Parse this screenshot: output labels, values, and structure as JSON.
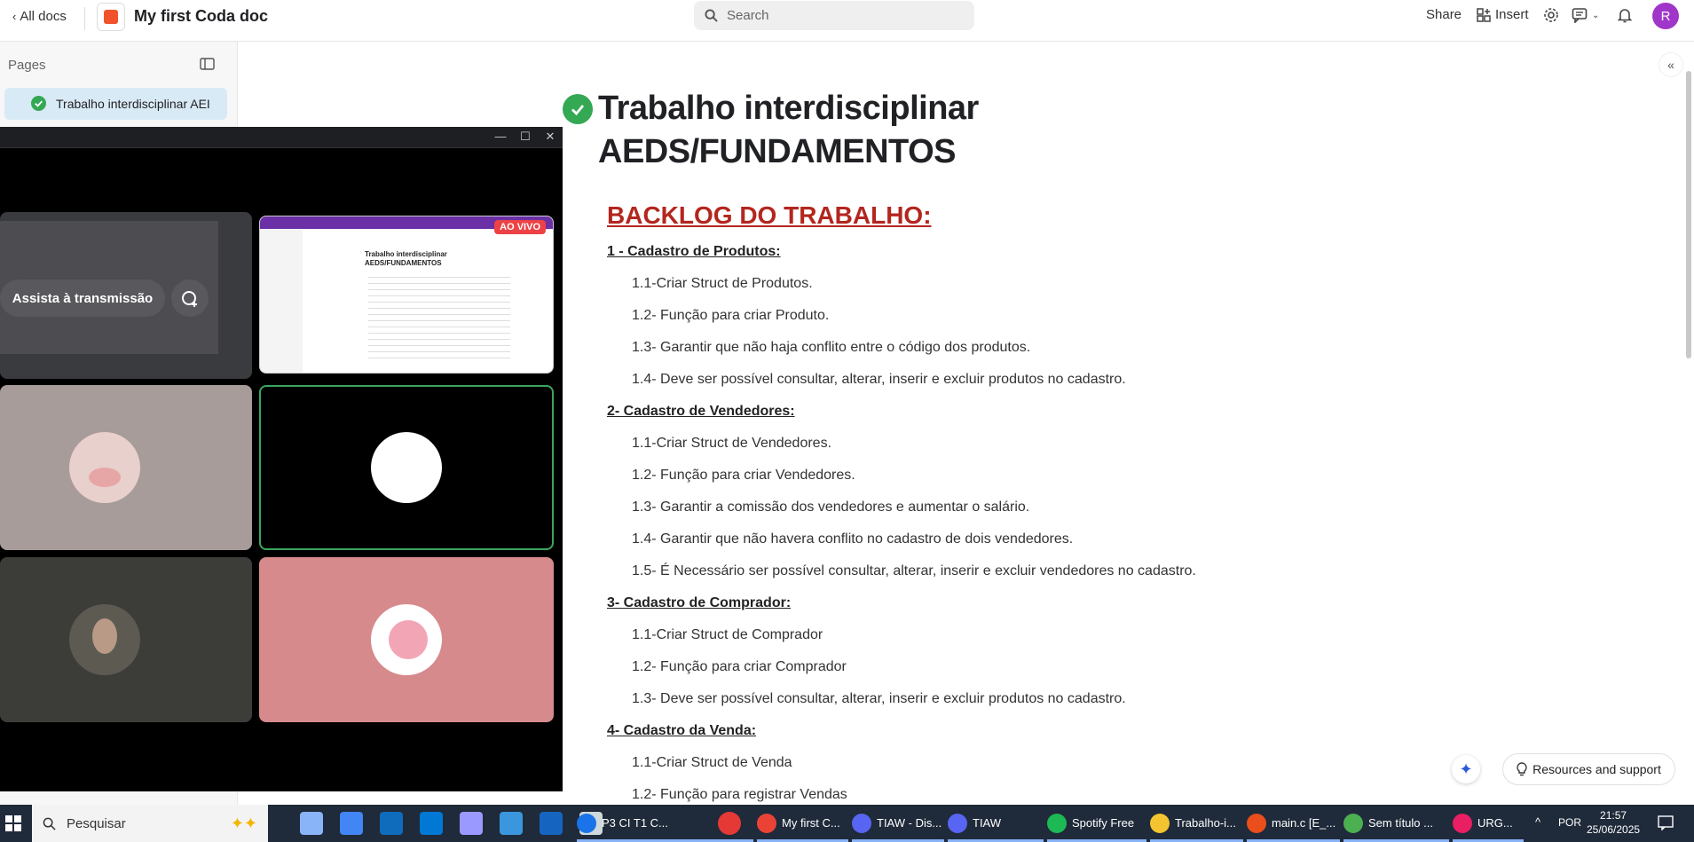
{
  "topbar": {
    "all_docs": "All docs",
    "doc_title": "My first Coda doc",
    "search_placeholder": "Search",
    "share": "Share",
    "insert": "Insert",
    "avatar_letter": "R"
  },
  "sidebar": {
    "pages_label": "Pages",
    "items": [
      {
        "label": "Trabalho interdisciplinar AEI",
        "icon": "check-circle-icon"
      }
    ]
  },
  "discord": {
    "watch_label": "Assista à transmissão",
    "live_badge": "AO VIVO"
  },
  "document": {
    "title_line1": "Trabalho interdisciplinar",
    "title_line2": "AEDS/FUNDAMENTOS",
    "backlog_heading": "BACKLOG DO TRABALHO:",
    "sections": [
      {
        "heading": "1 - Cadastro de Produtos:",
        "items": [
          "1.1-Criar Struct de Produtos.",
          "1.2- Função para criar Produto.",
          "1.3- Garantir que não haja conflito entre o código dos produtos.",
          "1.4- Deve ser possível consultar, alterar, inserir e excluir produtos no cadastro."
        ]
      },
      {
        "heading": "2- Cadastro de Vendedores:",
        "items": [
          "1.1-Criar Struct de Vendedores.",
          "1.2- Função para criar Vendedores.",
          "1.3- Garantir a comissão dos vendedores e aumentar o salário.",
          "1.4- Garantir que não havera conflito no cadastro de dois vendedores.",
          "1.5- É Necessário ser possível consultar, alterar, inserir e excluir vendedores no cadastro."
        ]
      },
      {
        "heading": "3- Cadastro de Comprador:",
        "items": [
          "1.1-Criar Struct de Comprador",
          "1.2- Função para criar Comprador",
          "1.3- Deve ser possível consultar, alterar, inserir e excluir produtos no cadastro."
        ]
      },
      {
        "heading": "4- Cadastro da Venda:",
        "items": [
          "1.1-Criar Struct de Venda",
          "1.2- Função para registrar Vendas"
        ]
      }
    ]
  },
  "resources_label": "Resources and support",
  "taskbar": {
    "search_placeholder": "Pesquisar",
    "apps": [
      {
        "label": "P3 CI T1 C...",
        "color": "#1a73e8"
      },
      {
        "label": "My first C...",
        "color": "#ea4335"
      },
      {
        "label": "TIAW - Dis...",
        "color": "#5865f2"
      },
      {
        "label": "TIAW",
        "color": "#5865f2"
      },
      {
        "label": "Spotify Free",
        "color": "#1db954"
      },
      {
        "label": "Trabalho-i...",
        "color": "#f4c430"
      },
      {
        "label": "main.c [E_...",
        "color": "#e94e1b"
      },
      {
        "label": "Sem título ...",
        "color": "#4caf50"
      },
      {
        "label": "URG...",
        "color": "#e91e63"
      }
    ],
    "lang": "POR",
    "time": "21:57",
    "date": "25/06/2025"
  }
}
